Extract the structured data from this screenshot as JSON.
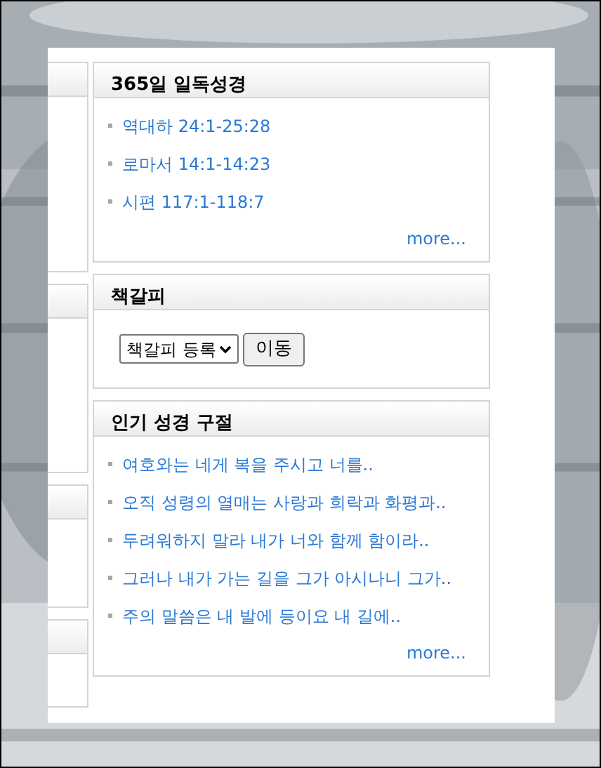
{
  "sections": [
    {
      "kind": "links",
      "title": "365일 일독성경",
      "items": [
        "역대하 24:1-25:28",
        "로마서 14:1-14:23",
        "시편 117:1-118:7"
      ],
      "more": "more..."
    },
    {
      "kind": "bookmark",
      "title": "책갈피",
      "select": {
        "value": "책갈피 등록"
      },
      "button": "이동"
    },
    {
      "kind": "links",
      "title": "인기 성경 구절",
      "items": [
        "여호와는 네게 복을 주시고 너를..",
        "오직 성령의 열매는 사랑과 희락과 화평과..",
        "두려워하지 말라 내가 너와 함께 함이라..",
        "그러나 내가 가는 길을 그가 아시나니 그가..",
        "주의 말씀은 내 발에 등이요 내 길에.."
      ],
      "more": "more..."
    }
  ]
}
